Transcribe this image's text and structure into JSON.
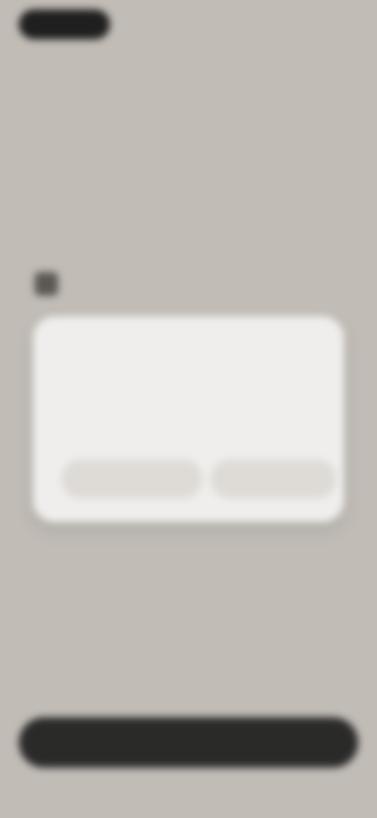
{
  "title": "",
  "subtitle": "",
  "section": {
    "label": "",
    "icon": "app-icon"
  },
  "card": {
    "title": "",
    "body": "",
    "left_button": "",
    "right_button": ""
  },
  "footer": {
    "left": "",
    "right": ""
  },
  "bottom_button": {
    "label": ""
  },
  "status_right": ""
}
